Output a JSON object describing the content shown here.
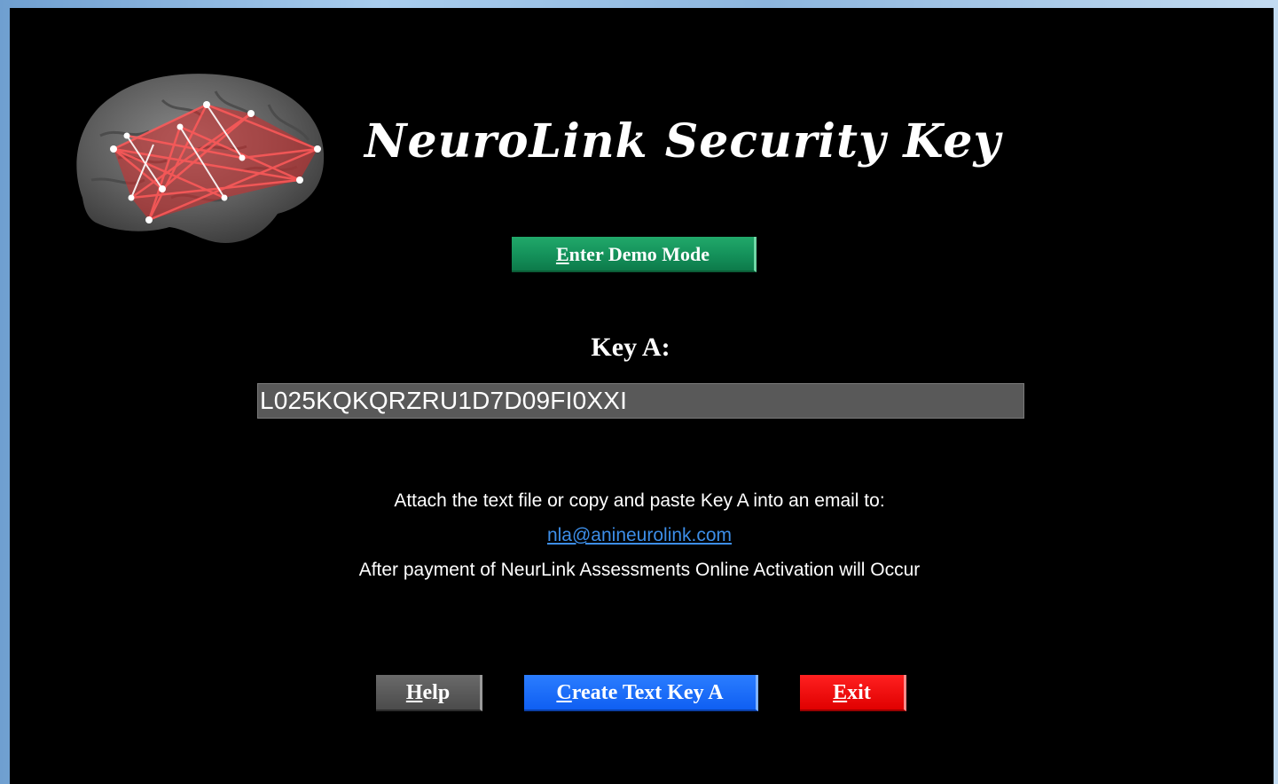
{
  "app": {
    "title": "NeuroLink Security Key"
  },
  "demo": {
    "button_label": "Enter Demo Mode",
    "mnemonic": "E",
    "rest": "nter Demo Mode"
  },
  "key": {
    "label": "Key A:",
    "value": "L025KQKQRZRU1D7D09FI0XXI"
  },
  "info": {
    "line1": "Attach the text file or copy and paste Key A into an email to:",
    "email": "nla@anineurolink.com",
    "line2": "After payment of NeurLink Assessments Online Activation will Occur"
  },
  "buttons": {
    "help": {
      "label": "Help",
      "mnemonic": "H",
      "rest": "elp"
    },
    "create": {
      "label": "Create Text Key A",
      "mnemonic": "C",
      "rest": "reate Text Key A"
    },
    "exit": {
      "label": "Exit",
      "mnemonic": "E",
      "rest": "xit"
    }
  },
  "colors": {
    "background": "#000000",
    "demo_button": "#14915a",
    "help_button": "#4b4b4b",
    "create_button": "#0f5ff2",
    "exit_button": "#e00000",
    "link": "#3d8ee8",
    "key_field": "#595959"
  }
}
